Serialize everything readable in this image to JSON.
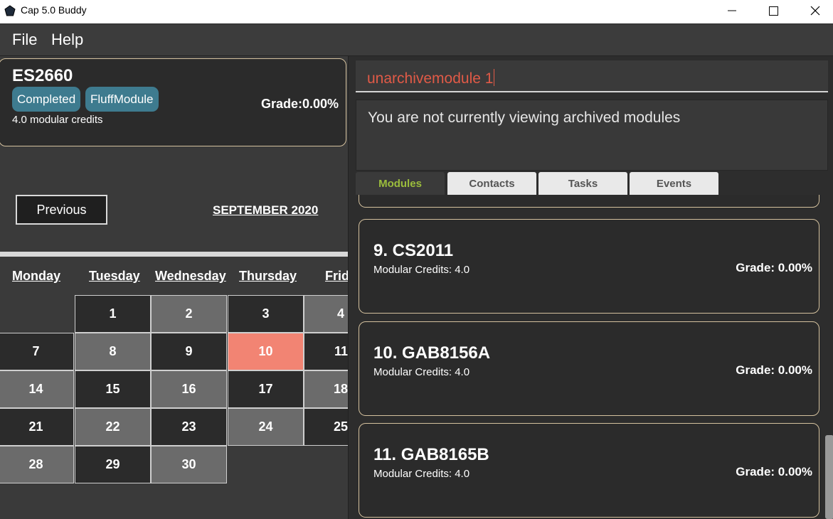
{
  "window": {
    "title": "Cap 5.0 Buddy",
    "icons": {
      "app": "pentagon-app-icon",
      "minimize": "minimize-icon",
      "maximize": "maximize-icon",
      "close": "close-icon"
    }
  },
  "menu": {
    "file": "File",
    "help": "Help"
  },
  "module_card": {
    "code": "ES2660",
    "tags": [
      "Completed",
      "FluffModule"
    ],
    "credits": "4.0 modular credits",
    "grade": "Grade:0.00%",
    "tag_color": "#3e7b8f",
    "border_color": "#d4c19e"
  },
  "calendar": {
    "previous_label": "Previous",
    "month": "SEPTEMBER 2020",
    "days": [
      "Monday",
      "Tuesday",
      "Wednesday",
      "Thursday",
      "Frid"
    ],
    "weeks": [
      [
        "",
        "1",
        "2",
        "3",
        "4"
      ],
      [
        "7",
        "8",
        "9",
        "10",
        "11"
      ],
      [
        "14",
        "15",
        "16",
        "17",
        "18"
      ],
      [
        "21",
        "22",
        "23",
        "24",
        "25"
      ],
      [
        "28",
        "29",
        "30",
        "",
        ""
      ]
    ],
    "today": "10",
    "today_color": "#f28473"
  },
  "command": {
    "input_value": "unarchivemodule 1",
    "result": "You are not currently viewing archived modules"
  },
  "tabs": [
    {
      "label": "Modules",
      "active": true
    },
    {
      "label": "Contacts",
      "active": false
    },
    {
      "label": "Tasks",
      "active": false
    },
    {
      "label": "Events",
      "active": false
    }
  ],
  "module_list": [
    {
      "title": "9.  CS2011",
      "credits": "Modular Credits: 4.0",
      "grade": "Grade: 0.00%"
    },
    {
      "title": "10.  GAB8156A",
      "credits": "Modular Credits: 4.0",
      "grade": "Grade: 0.00%"
    },
    {
      "title": "11.  GAB8165B",
      "credits": "Modular Credits: 4.0",
      "grade": "Grade: 0.00%"
    }
  ],
  "colors": {
    "active_tab": "#9bbd3c",
    "command_text": "#e05a47"
  }
}
